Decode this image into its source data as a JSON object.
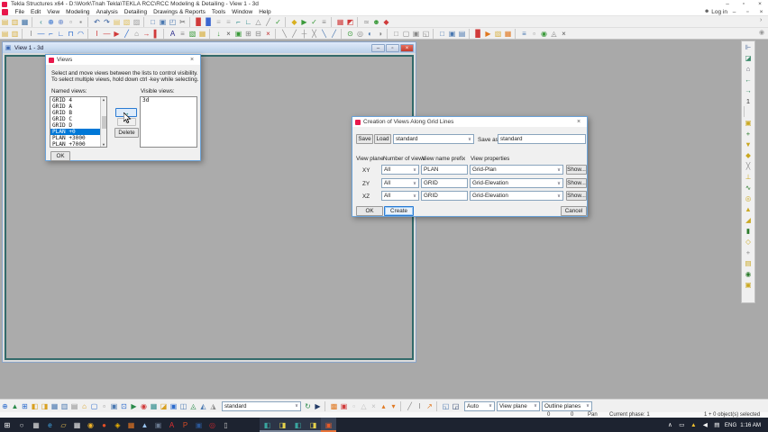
{
  "ui": {
    "min": "–",
    "restore": "▫",
    "close": "×",
    "caret": "∨",
    "person": "☻",
    "chev": "›",
    "gear": "◉",
    "scroll_up": "▲",
    "scroll_down": "▼",
    "win_restore": "▣"
  },
  "titlebar": {
    "title": "Tekla Structures x64 - D:\\Work\\Tnah Tekla\\TEKLA RCC\\RCC Modeling & Detailing  - View 1 - 3d"
  },
  "menubar": {
    "items": [
      "File",
      "Edit",
      "View",
      "Modeling",
      "Analysis",
      "Detailing",
      "Drawings & Reports",
      "Tools",
      "Window",
      "Help"
    ],
    "login_label": "Log in"
  },
  "toolbars": {
    "row1": [
      {
        "t": "▤",
        "c": "#d8b040",
        "n": "open-model-icon"
      },
      {
        "t": "▥",
        "c": "#d8b040",
        "n": "new-model-icon"
      },
      {
        "t": "▦",
        "c": "#3a6ea5",
        "n": "save-icon"
      },
      {
        "t": "",
        "cls": "sep"
      },
      {
        "t": "‹",
        "c": "#2a8a8a",
        "n": "back-icon"
      },
      {
        "t": "⊕",
        "c": "#2a6acc",
        "n": "zoom-in-icon"
      },
      {
        "t": "⊕",
        "c": "#6a8acc",
        "n": "zoom-out-icon"
      },
      {
        "t": "▫",
        "c": "#888",
        "n": "pan-icon"
      },
      {
        "t": "▪",
        "c": "#888",
        "n": "fit-icon"
      },
      {
        "t": "",
        "cls": "sep"
      },
      {
        "t": "↶",
        "c": "#2b579a",
        "n": "undo-icon"
      },
      {
        "t": "↷",
        "c": "#2b579a",
        "n": "redo-icon"
      },
      {
        "t": "▤",
        "c": "#e0c060",
        "n": "copy-icon"
      },
      {
        "t": "▧",
        "c": "#e0c060",
        "n": "paste-icon"
      },
      {
        "t": "▨",
        "c": "#a0a0a0",
        "n": "clipboard-icon"
      },
      {
        "t": "",
        "cls": "sep"
      },
      {
        "t": "□",
        "c": "#4a78b0",
        "n": "new-view-icon"
      },
      {
        "t": "▣",
        "c": "#4a78b0",
        "n": "view-list-icon"
      },
      {
        "t": "◰",
        "c": "#4a78b0",
        "n": "split-view-icon"
      },
      {
        "t": "✂",
        "c": "#555",
        "n": "cut-icon"
      },
      {
        "t": "",
        "cls": "sep"
      },
      {
        "t": "▉",
        "c": "#d03a3a",
        "n": "phase-icon"
      },
      {
        "t": "▉",
        "c": "#3a66d0",
        "n": "lotting-icon"
      },
      {
        "t": "≡",
        "c": "#b0b0b0",
        "n": "list-icon"
      },
      {
        "t": "≡",
        "c": "#b0b0b0",
        "n": "report-icon"
      },
      {
        "t": "⌐",
        "c": "#2a8a8a",
        "n": "measure-icon"
      },
      {
        "t": "∟",
        "c": "#2a8a8a",
        "n": "measure-angle-icon"
      },
      {
        "t": "△",
        "c": "#888",
        "n": "measure-area-icon"
      },
      {
        "t": "╱",
        "c": "#888",
        "n": "measure-line-icon"
      },
      {
        "t": "✓",
        "c": "#3a9a3a",
        "n": "check-icon"
      },
      {
        "t": "",
        "cls": "sep"
      },
      {
        "t": "◆",
        "c": "#d8b020",
        "n": "diamond-tool-icon"
      },
      {
        "t": "▶",
        "c": "#3a9a3a",
        "n": "run-icon"
      },
      {
        "t": "✓",
        "c": "#3a9a3a",
        "n": "clash-check-icon"
      },
      {
        "t": "≡",
        "c": "#888",
        "n": "log-icon"
      },
      {
        "t": "",
        "cls": "sep"
      },
      {
        "t": "▦",
        "c": "#d03a3a",
        "n": "component-catalog-icon"
      },
      {
        "t": "◩",
        "c": "#d03a3a",
        "n": "custom-component-icon"
      },
      {
        "t": "",
        "cls": "sep"
      },
      {
        "t": "≃",
        "c": "#888",
        "n": "compare-icon"
      },
      {
        "t": "☻",
        "c": "#3a9a3a",
        "n": "collaborate-icon"
      },
      {
        "t": "◆",
        "c": "#d03a3a",
        "n": "trimble-connect-icon"
      }
    ],
    "row2": [
      {
        "t": "▤",
        "c": "#d8b040",
        "n": "open-drawing-icon"
      },
      {
        "t": "▥",
        "c": "#d8b040",
        "n": "drawing-list-icon"
      },
      {
        "t": "",
        "cls": "sep"
      },
      {
        "t": "I",
        "c": "#888",
        "n": "column-tool-icon"
      },
      {
        "t": "—",
        "c": "#2a6acc",
        "n": "beam-tool-icon"
      },
      {
        "t": "⌐",
        "c": "#2a6acc",
        "n": "polybeam-icon"
      },
      {
        "t": "∟",
        "c": "#2a6acc",
        "n": "bent-beam-icon"
      },
      {
        "t": "⊓",
        "c": "#2a6acc",
        "n": "portal-icon"
      },
      {
        "t": "◠",
        "c": "#2a6acc",
        "n": "curved-beam-icon"
      },
      {
        "t": "",
        "cls": "sep"
      },
      {
        "t": "I",
        "c": "#d03a3a",
        "n": "concrete-column-icon"
      },
      {
        "t": "—",
        "c": "#d03a3a",
        "n": "concrete-beam-icon"
      },
      {
        "t": "▶",
        "c": "#d03a3a",
        "n": "pad-footing-icon"
      },
      {
        "t": "╱",
        "c": "#2a6acc",
        "n": "strip-footing-icon"
      },
      {
        "t": "⌂",
        "c": "#888",
        "n": "slab-icon"
      },
      {
        "t": "→",
        "c": "#d03a3a",
        "n": "panel-icon"
      },
      {
        "t": "▌",
        "c": "#d03a3a",
        "n": "wall-icon"
      },
      {
        "t": "",
        "cls": "sep"
      },
      {
        "t": "A",
        "c": "#2a2a8a",
        "n": "text-tool-icon"
      },
      {
        "t": "≡",
        "c": "#888",
        "n": "text-list-icon"
      },
      {
        "t": "▧",
        "c": "#3a9a3a",
        "n": "mesh-icon"
      },
      {
        "t": "▦",
        "c": "#d8b040",
        "n": "surface-icon"
      },
      {
        "t": "",
        "cls": "sep"
      },
      {
        "t": "↓",
        "c": "#3a9a3a",
        "n": "point-tool-icon"
      },
      {
        "t": "×",
        "c": "#555",
        "n": "construction-point-icon"
      },
      {
        "t": "▣",
        "c": "#3a9a3a",
        "n": "grid-icon"
      },
      {
        "t": "⊞",
        "c": "#888",
        "n": "grid-edit-icon"
      },
      {
        "t": "⊟",
        "c": "#888",
        "n": "grid-line-icon"
      },
      {
        "t": "×",
        "c": "#c03030",
        "n": "delete-icon"
      },
      {
        "t": "",
        "cls": "sep"
      },
      {
        "t": "╲",
        "c": "#888",
        "n": "snap-line-icon"
      },
      {
        "t": "╱",
        "c": "#888",
        "n": "snap-cross-icon"
      },
      {
        "t": "┼",
        "c": "#888",
        "n": "snap-intersection-icon"
      },
      {
        "t": "╳",
        "c": "#888",
        "n": "snap-any-icon"
      },
      {
        "t": "╲",
        "c": "#4a78b0",
        "n": "snap-end-icon"
      },
      {
        "t": "╱",
        "c": "#4a78b0",
        "n": "snap-mid-icon"
      },
      {
        "t": "",
        "cls": "sep"
      },
      {
        "t": "⊙",
        "c": "#3a9a3a",
        "n": "snap-center-icon"
      },
      {
        "t": "◎",
        "c": "#888",
        "n": "snap-arc-icon"
      },
      {
        "t": "◐",
        "c": "#4a78b0",
        "n": "snap-tangent-icon"
      },
      {
        "t": "◑",
        "c": "#888",
        "n": "snap-perp-icon"
      },
      {
        "t": "",
        "cls": "sep"
      },
      {
        "t": "□",
        "c": "#888",
        "n": "view-basic-icon"
      },
      {
        "t": "▢",
        "c": "#888",
        "n": "view-rendered-icon"
      },
      {
        "t": "▣",
        "c": "#888",
        "n": "view-wireframe-icon"
      },
      {
        "t": "◱",
        "c": "#888",
        "n": "view-plane-icon"
      },
      {
        "t": "",
        "cls": "sep"
      },
      {
        "t": "□",
        "c": "#4a78b0",
        "n": "comp-view-icon"
      },
      {
        "t": "▣",
        "c": "#4a78b0",
        "n": "comp-edit-icon"
      },
      {
        "t": "▤",
        "c": "#4a78b0",
        "n": "comp-list-icon"
      },
      {
        "t": "",
        "cls": "sep"
      },
      {
        "t": "▉",
        "c": "#d03a3a",
        "n": "numbering-icon"
      },
      {
        "t": "▶",
        "c": "#e07820",
        "n": "publish-icon"
      },
      {
        "t": "▧",
        "c": "#d8b040",
        "n": "organizer-icon"
      },
      {
        "t": "▦",
        "c": "#e07820",
        "n": "task-manager-icon"
      },
      {
        "t": "",
        "cls": "sep"
      },
      {
        "t": "≡",
        "c": "#4a78b0",
        "n": "filter-icon"
      },
      {
        "t": "▫",
        "c": "#888",
        "n": "misc-a-icon"
      },
      {
        "t": "◉",
        "c": "#3a9a3a",
        "n": "misc-b-icon"
      },
      {
        "t": "◬",
        "c": "#888",
        "n": "misc-c-icon"
      },
      {
        "t": "×",
        "c": "#555",
        "n": "close-tool-icon"
      }
    ],
    "bottom_left": [
      {
        "t": "⊕",
        "c": "#2a6acc",
        "n": "create-view-icon"
      },
      {
        "t": "▲",
        "c": "#2a8a4a",
        "n": "fly-icon"
      },
      {
        "t": "⊞",
        "c": "#2a6acc",
        "n": "grid-view-icon"
      },
      {
        "t": "◧",
        "c": "#d8a020",
        "n": "basic-view-icon"
      },
      {
        "t": "◨",
        "c": "#d8a020",
        "n": "view-along-grid-icon"
      },
      {
        "t": "▦",
        "c": "#4a78b0",
        "n": "view-3d-icon"
      },
      {
        "t": "▥",
        "c": "#4a78b0",
        "n": "view-plane2-icon"
      },
      {
        "t": "▤",
        "c": "#888",
        "n": "view-list2-icon"
      },
      {
        "t": "⌂",
        "c": "#d8a020",
        "n": "home-view-icon"
      },
      {
        "t": "▢",
        "c": "#2a6acc",
        "n": "clip-plane-icon"
      },
      {
        "t": "▫",
        "c": "#888",
        "n": "screenshot-icon"
      },
      {
        "t": "▣",
        "c": "#4a78b0",
        "n": "render-options-icon"
      },
      {
        "t": "⊡",
        "c": "#2a6acc",
        "n": "work-area-icon"
      },
      {
        "t": "▶",
        "c": "#2a8a4a",
        "n": "flight-icon"
      },
      {
        "t": "◉",
        "c": "#d03a3a",
        "n": "camera-icon"
      },
      {
        "t": "▦",
        "c": "#2a8a8a",
        "n": "visibility-icon"
      },
      {
        "t": "◪",
        "c": "#d8a020",
        "n": "representation-icon"
      },
      {
        "t": "▣",
        "c": "#2a6acc",
        "n": "display-icon"
      },
      {
        "t": "◫",
        "c": "#4a78b0",
        "n": "dual-view-icon"
      },
      {
        "t": "◬",
        "c": "#2a8a4a",
        "n": "iso-view-icon"
      },
      {
        "t": "◭",
        "c": "#4a78b0",
        "n": "rotate-view-icon"
      },
      {
        "t": "◮",
        "c": "#888",
        "n": "spin-view-icon"
      }
    ],
    "bottom_right": [
      {
        "t": "↻",
        "c": "#2a8a4a",
        "n": "reload-preset-icon"
      },
      {
        "t": "▶",
        "c": "#223a66",
        "n": "select-cursor-icon"
      },
      {
        "t": "",
        "cls": "sep"
      },
      {
        "t": "▩",
        "c": "#e07820",
        "n": "select-all-mode-icon"
      },
      {
        "t": "▣",
        "c": "#d03a3a",
        "n": "select-component-icon"
      },
      {
        "t": "▫",
        "c": "#c0c0c0",
        "n": "select-assembly-icon"
      },
      {
        "t": "△",
        "c": "#c0c0c0",
        "n": "select-object-icon"
      },
      {
        "t": "×",
        "c": "#c0c0c0",
        "n": "select-point-icon"
      },
      {
        "t": "▴",
        "c": "#e07820",
        "n": "select-part-icon"
      },
      {
        "t": "▾",
        "c": "#e07820",
        "n": "select-rebar-icon"
      },
      {
        "t": "",
        "cls": "sep"
      },
      {
        "t": "╱",
        "c": "#888",
        "n": "select-weld-icon"
      },
      {
        "t": "I",
        "c": "#888",
        "n": "select-bolt-icon"
      },
      {
        "t": "↗",
        "c": "#e07820",
        "n": "select-line-icon"
      },
      {
        "t": "",
        "cls": "sep"
      },
      {
        "t": "◱",
        "c": "#4a78b0",
        "n": "snap-mode-a-icon"
      },
      {
        "t": "◲",
        "c": "#223a66",
        "n": "snap-mode-b-icon"
      }
    ],
    "right_vertical": [
      {
        "t": "⊩",
        "c": "#4a6a9a",
        "n": "snap-settings-icon"
      },
      {
        "t": "◪",
        "c": "#3a8a6a",
        "n": "snap-ortho-icon"
      },
      {
        "t": "⌂",
        "c": "#556",
        "n": "snap-origin-icon"
      },
      {
        "t": "←",
        "c": "#1a7a4a",
        "n": "snap-prev-icon"
      },
      {
        "t": "→",
        "c": "#1a7a4a",
        "n": "snap-next-icon"
      },
      {
        "t": "1",
        "c": "#333",
        "n": "snap-depth-icon"
      },
      {
        "t": "",
        "cls": "sep"
      },
      {
        "t": "▣",
        "c": "#caa820",
        "n": "snap-points-icon"
      },
      {
        "t": "+",
        "c": "#2a7a2a",
        "n": "snap-endpoint-icon"
      },
      {
        "t": "▼",
        "c": "#caa820",
        "n": "snap-centerpoint-icon"
      },
      {
        "t": "◆",
        "c": "#caa820",
        "n": "snap-midpoint-icon"
      },
      {
        "t": "╳",
        "c": "#888",
        "n": "snap-intersect-icon"
      },
      {
        "t": "⊥",
        "c": "#caa820",
        "n": "snap-perpendicular-icon"
      },
      {
        "t": "∿",
        "c": "#2a7a2a",
        "n": "snap-tangent2-icon"
      },
      {
        "t": "◎",
        "c": "#caa820",
        "n": "snap-nearest-icon"
      },
      {
        "t": "▲",
        "c": "#caa820",
        "n": "snap-grid-icon"
      },
      {
        "t": "◢",
        "c": "#caa820",
        "n": "snap-extension-icon"
      },
      {
        "t": "▮",
        "c": "#2a7a2a",
        "n": "snap-reference-icon"
      },
      {
        "t": "◇",
        "c": "#caa820",
        "n": "snap-free-icon"
      },
      {
        "t": "+",
        "c": "#888",
        "n": "snap-any2-icon"
      },
      {
        "t": "▤",
        "c": "#caa820",
        "n": "snap-lines-icon"
      },
      {
        "t": "◉",
        "c": "#2a7a2a",
        "n": "snap-bolt-icon"
      },
      {
        "t": "▣",
        "c": "#caa820",
        "n": "snap-edge-icon"
      }
    ]
  },
  "view_window": {
    "title": "View 1 - 3d"
  },
  "views_dialog": {
    "title": "Views",
    "instruction1": "Select and move views between the lists to control visibility.",
    "instruction2": "To select multiple views, hold down ctrl -key while selecting.",
    "named_label": "Named views:",
    "visible_label": "Visible views:",
    "named": [
      {
        "t": "GRID 4"
      },
      {
        "t": "GRID A"
      },
      {
        "t": "GRID B"
      },
      {
        "t": "GRID C"
      },
      {
        "t": "GRID D"
      },
      {
        "t": "PLAN +0",
        "cls": "sel"
      },
      {
        "t": "PLAN +3000"
      },
      {
        "t": "PLAN +7000"
      }
    ],
    "visible": [
      {
        "t": "3d"
      }
    ],
    "move_right": "→",
    "move_left": "←",
    "delete_label": "Delete",
    "ok_label": "OK"
  },
  "creation_dialog": {
    "title": "Creation of Views Along Grid Lines",
    "save_label": "Save",
    "load_label": "Load",
    "preset_value": "standard",
    "save_as_label": "Save as",
    "save_as_value": "standard",
    "headers": {
      "plane": "View plane",
      "num": "Number of views",
      "prefix": "View name prefix",
      "props": "View properties"
    },
    "rows": [
      {
        "plane": "XY",
        "num": "All",
        "prefix": "PLAN",
        "props": "Grid-Plan",
        "show": "Show..."
      },
      {
        "plane": "ZY",
        "num": "All",
        "prefix": "GRID",
        "props": "Grid-Elevation",
        "show": "Show..."
      },
      {
        "plane": "XZ",
        "num": "All",
        "prefix": "GRID",
        "props": "Grid-Elevation",
        "show": "Show..."
      }
    ],
    "ok_label": "OK",
    "create_label": "Create",
    "cancel_label": "Cancel"
  },
  "bottom_toolbar": {
    "preset_value": "standard",
    "auto_value": "Auto",
    "viewplane_value": "View plane",
    "outline_value": "Outline planes"
  },
  "statusbar": {
    "x": "0",
    "y": "0",
    "mode": "Pan",
    "phase": "Current phase: 1",
    "selected": "1 + 0 object(s) selected"
  },
  "taskbar": {
    "system": [
      {
        "t": "⊞",
        "c": "#fff",
        "n": "start-button"
      },
      {
        "t": "○",
        "c": "#ddd",
        "n": "cortana-search-button"
      },
      {
        "t": "▦",
        "c": "#ddd",
        "n": "task-view-button"
      }
    ],
    "apps": [
      {
        "t": "e",
        "c": "#40a8e8",
        "n": "edge-icon"
      },
      {
        "t": "▱",
        "c": "#f0c452",
        "n": "file-explorer-icon"
      },
      {
        "t": "▦",
        "c": "#e8e8e8",
        "n": "store-icon"
      },
      {
        "t": "◉",
        "c": "#f0b429",
        "n": "chrome-icon"
      },
      {
        "t": "●",
        "c": "#e34f26",
        "n": "firefox-icon"
      },
      {
        "t": "◈",
        "c": "#f0b400",
        "n": "plugin-icon"
      },
      {
        "t": "▦",
        "c": "#e87722",
        "n": "office-icon"
      },
      {
        "t": "▲",
        "c": "#9ac4f0",
        "n": "photos-icon"
      },
      {
        "t": "▣",
        "c": "#6a7a90",
        "n": "media-icon"
      },
      {
        "t": "A",
        "c": "#e03030",
        "n": "autocad-icon"
      },
      {
        "t": "P",
        "c": "#d24b26",
        "n": "powerpoint-icon"
      },
      {
        "t": "▣",
        "c": "#2b5797",
        "n": "word-icon"
      },
      {
        "t": "◎",
        "c": "#c1272d",
        "n": "opera-icon"
      },
      {
        "t": "▯",
        "c": "#c0c0c0",
        "n": "phone-icon"
      },
      {
        "t": "◧",
        "c": "#3aa6a0",
        "n": "tekla-tool-a-icon",
        "cls": "act gap"
      },
      {
        "t": "◨",
        "c": "#e8d44c",
        "n": "tekla-tool-b-icon",
        "cls": "act"
      },
      {
        "t": "◧",
        "c": "#3aa6a0",
        "n": "tekla-tool-c-icon",
        "cls": "act"
      },
      {
        "t": "◨",
        "c": "#e8d44c",
        "n": "tekla-tool-d-icon",
        "cls": "act"
      },
      {
        "t": "▣",
        "c": "#e85c28",
        "n": "tekla-structures-icon",
        "cls": "act cur"
      }
    ],
    "tray_icons": [
      {
        "t": "∧",
        "c": "#fff",
        "n": "tray-expand-icon"
      },
      {
        "t": "▭",
        "c": "#fff",
        "n": "network-icon"
      },
      {
        "t": "▲",
        "c": "#f2c230",
        "n": "drive-icon"
      },
      {
        "t": "◀",
        "c": "#fff",
        "n": "volume-icon"
      },
      {
        "t": "▤",
        "c": "#fff",
        "n": "touch-keyboard-icon"
      }
    ],
    "lang": "ENG",
    "clock": "1:16 AM"
  }
}
